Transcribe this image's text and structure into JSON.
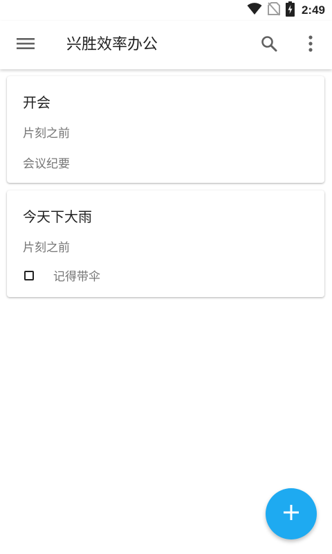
{
  "status_bar": {
    "time": "2:49",
    "icons": [
      "wifi-icon",
      "no-sim-icon",
      "battery-charging-icon"
    ]
  },
  "app_bar": {
    "title": "兴胜效率办公",
    "icons": {
      "menu": "menu-icon",
      "search": "search-icon",
      "more": "more-vert-icon"
    }
  },
  "notes": [
    {
      "title": "开会",
      "time": "片刻之前",
      "body": "会议纪要"
    },
    {
      "title": "今天下大雨",
      "time": "片刻之前",
      "checklist": [
        {
          "label": "记得带伞",
          "checked": false
        }
      ]
    }
  ],
  "fab": {
    "icon": "add-icon"
  },
  "colors": {
    "accent": "#1eaaf1",
    "text_primary": "#212121",
    "text_secondary": "#757575"
  }
}
